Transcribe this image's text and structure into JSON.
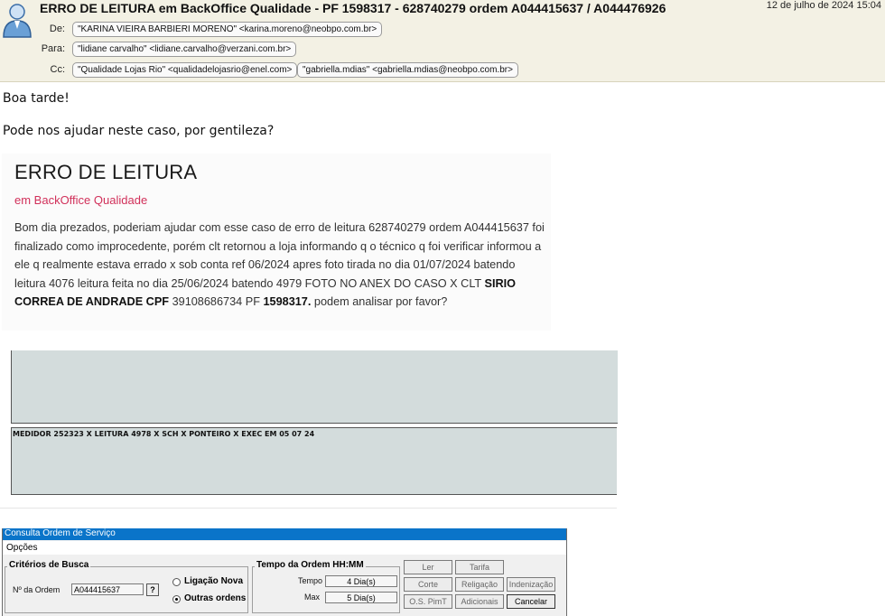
{
  "email": {
    "subject": "ERRO DE LEITURA em BackOffice Qualidade - PF 1598317 - 628740279 ordem A044415637 / A044476926",
    "date": "12 de julho de 2024 15:04",
    "from_label": "De:",
    "from": "\"KARINA VIEIRA BARBIERI MORENO\" <karina.moreno@neobpo.com.br>",
    "to_label": "Para:",
    "to": "\"lidiane carvalho\" <lidiane.carvalho@verzani.com.br>",
    "cc_label": "Cc:",
    "cc": [
      "\"Qualidade Lojas Rio\" <qualidadelojasrio@enel.com>",
      "\"gabriella.mdias\" <gabriella.mdias@neobpo.com.br>"
    ]
  },
  "body": {
    "greeting": "Boa tarde!",
    "request": "Pode nos ajudar neste caso, por gentileza?"
  },
  "card": {
    "title": "ERRO DE LEITURA",
    "subtitle": "em BackOffice Qualidade",
    "text_a": "Bom dia prezados, poderiam ajudar com esse caso de erro de leitura 628740279 ordem A044415637 foi finalizado como improcedente, porém clt retornou a loja informando q o técnico q foi verificar informou a ele q realmente estava errado x sob conta ref 06/2024 apres foto tirada no dia 01/07/2024 batendo leitura 4076 leitura feita no dia 25/06/2024 batendo 4979 FOTO NO ANEX DO CASO  X  CLT ",
    "text_name": "SIRIO CORREA DE ANDRADE CPF",
    "text_b": " 39108686734 PF ",
    "text_pf": "1598317.",
    "text_c": " podem analisar por favor?"
  },
  "photo": {
    "caption": "MEDIDOR 252323 X LEITURA 4978 X SCH X PONTEIRO X EXEC EM 05 07 24"
  },
  "app": {
    "title": "Consulta Ordem de Serviço",
    "menu": "Opções",
    "criteria_title": "Critérios de Busca",
    "order_label": "Nº da Ordem",
    "order_value": "A044415637",
    "help_button": "?",
    "radio_new": "Ligação Nova",
    "radio_other": "Outras ordens",
    "time_title": "Tempo da Ordem HH:MM",
    "time_label": "Tempo",
    "time_value": "4 Dia(s)",
    "max_label": "Max",
    "max_value": "5 Dia(s)",
    "buttons": [
      "Ler",
      "Tarifa",
      "Corte",
      "Religação",
      "Indenização",
      "O.S. PimT",
      "Adicionais",
      "Cancelar"
    ]
  }
}
